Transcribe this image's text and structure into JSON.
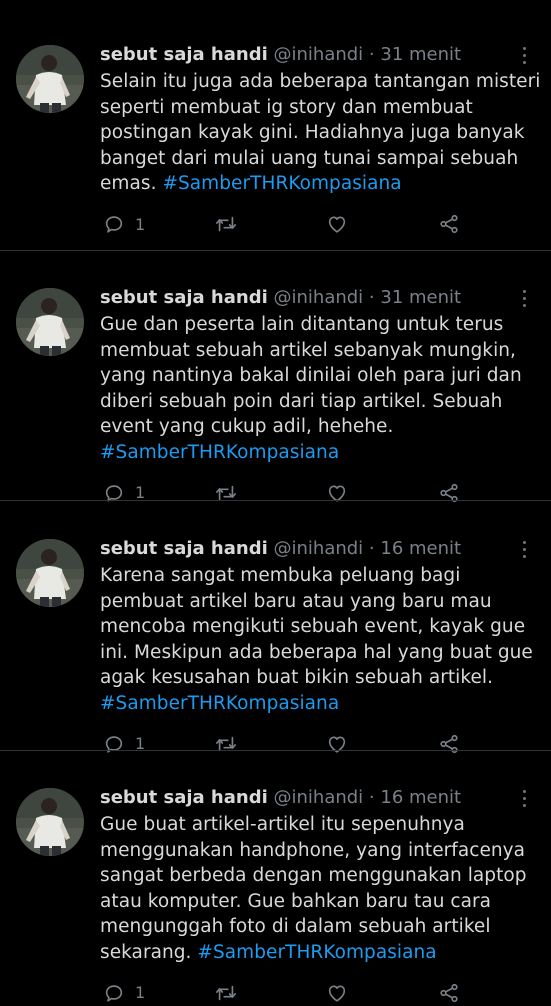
{
  "colors": {
    "background": "#000000",
    "text": "#d9d9d9",
    "muted": "#7a8088",
    "hashtag": "#1d9bf0",
    "divider": "#2f3336"
  },
  "tweets": [
    {
      "name": "sebut saja handi",
      "handle": "@inihandi",
      "separator": "·",
      "time": "31 menit",
      "lines": [
        "Selain itu juga ada beberapa tantangan misteri",
        "seperti membuat ig story dan membuat",
        "postingan kayak gini. Hadiahnya juga banyak",
        "banget dari mulai uang tunai sampai sebuah"
      ],
      "last_line_text": "emas. ",
      "hashtag": "#SamberTHRKompasiana",
      "reply_count": "1",
      "icons": [
        "reply-icon",
        "retweet-icon",
        "like-icon",
        "share-icon",
        "more-icon"
      ]
    },
    {
      "name": "sebut saja handi",
      "handle": "@inihandi",
      "separator": "·",
      "time": "31 menit",
      "lines": [
        "Gue dan peserta lain ditantang untuk terus",
        "membuat sebuah artikel sebanyak mungkin,",
        "yang nantinya bakal dinilai oleh para juri dan",
        "diberi sebuah poin dari tiap artikel. Sebuah",
        "event yang cukup adil, hehehe."
      ],
      "last_line_text": "",
      "hashtag": "#SamberTHRKompasiana",
      "reply_count": "1",
      "icons": [
        "reply-icon",
        "retweet-icon",
        "like-icon",
        "share-icon",
        "more-icon"
      ]
    },
    {
      "name": "sebut saja handi",
      "handle": "@inihandi",
      "separator": "·",
      "time": "16 menit",
      "lines": [
        "Karena sangat membuka peluang bagi",
        "pembuat artikel baru atau yang baru mau",
        "mencoba mengikuti sebuah event, kayak gue",
        "ini. Meskipun ada beberapa hal yang buat gue",
        "agak kesusahan buat bikin sebuah artikel."
      ],
      "last_line_text": "",
      "hashtag": "#SamberTHRKompasiana",
      "reply_count": "1",
      "icons": [
        "reply-icon",
        "retweet-icon",
        "like-icon",
        "share-icon",
        "more-icon"
      ]
    },
    {
      "name": "sebut saja handi",
      "handle": "@inihandi",
      "separator": "·",
      "time": "16 menit",
      "lines": [
        "Gue buat artikel-artikel itu sepenuhnya",
        "menggunakan handphone, yang interfacenya",
        "sangat berbeda dengan menggunakan laptop",
        "atau komputer. Gue bahkan baru tau cara",
        "mengunggah foto di dalam sebuah artikel"
      ],
      "last_line_text": "sekarang. ",
      "hashtag": "#SamberTHRKompasiana",
      "reply_count": "1",
      "icons": [
        "reply-icon",
        "retweet-icon",
        "like-icon",
        "share-icon",
        "more-icon"
      ]
    }
  ]
}
